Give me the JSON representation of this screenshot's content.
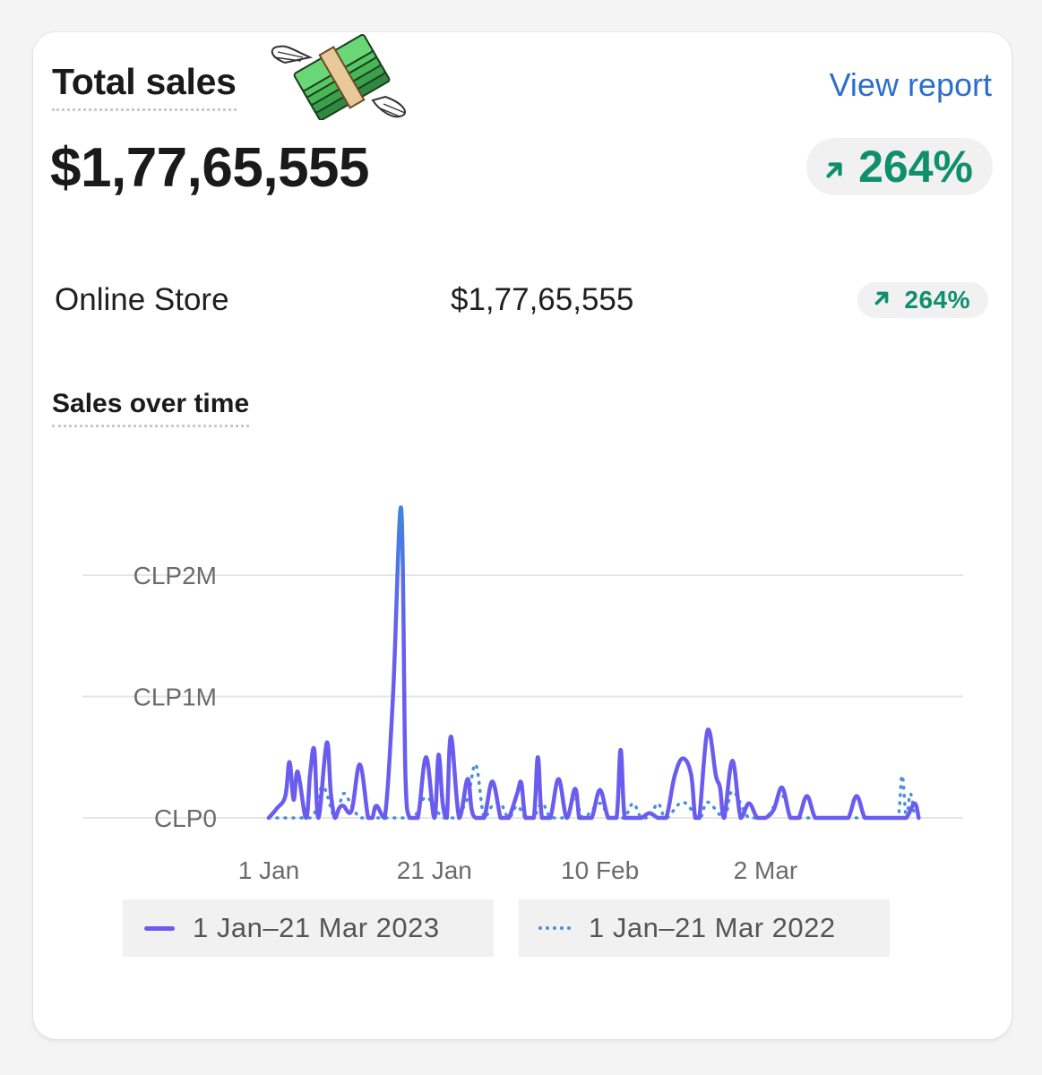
{
  "header": {
    "title": "Total sales",
    "view_report": "View report",
    "total_value": "$1,77,65,555",
    "change_pct": "264%",
    "change_icon": "arrow-up-right-icon",
    "illustration": "flying-money-icon"
  },
  "breakdown": [
    {
      "channel": "Online Store",
      "value": "$1,77,65,555",
      "change_pct": "264%"
    }
  ],
  "colors": {
    "accent_link": "#2c6ecb",
    "positive": "#0f8f6c",
    "series_current_top": "#3f85e0",
    "series_current": "#6b5cf0",
    "series_previous": "#4a90d9"
  },
  "chart_data": {
    "type": "line",
    "title": "Sales over time",
    "ylabel": "",
    "xlabel": "",
    "y_unit_prefix": "CLP",
    "ylim": [
      0,
      2000000
    ],
    "y_ticks": [
      0,
      1000000,
      2000000
    ],
    "y_tick_labels": [
      "CLP0",
      "CLP1M",
      "CLP2M"
    ],
    "x_ticks": [
      0,
      20,
      40,
      60
    ],
    "x_tick_labels": [
      "1 Jan",
      "21 Jan",
      "10 Feb",
      "2 Mar"
    ],
    "x_range": [
      0,
      79
    ],
    "grid": true,
    "legend": "bottom",
    "series": [
      {
        "name": "1 Jan–21 Mar 2023",
        "style": "solid",
        "x": [
          0,
          1,
          2,
          2.5,
          3,
          3.5,
          4.5,
          5,
          5.5,
          6,
          7,
          7.5,
          8,
          8.5,
          9,
          10,
          11,
          12,
          12.5,
          13,
          14,
          15,
          16,
          16.5,
          17,
          18,
          19,
          20,
          20.5,
          21,
          21.5,
          22,
          23,
          24,
          24.5,
          25,
          26,
          27,
          28,
          28.5,
          29,
          30,
          30.5,
          31,
          32,
          32.5,
          33,
          34,
          35,
          36,
          37,
          37.5,
          38,
          39,
          40,
          41,
          42,
          42.5,
          43,
          44,
          45,
          46,
          47,
          48,
          49,
          50,
          51,
          51.5,
          52,
          53,
          54,
          54.5,
          55,
          56,
          57,
          58,
          59,
          60,
          61,
          62,
          63,
          64,
          65,
          66,
          67,
          68,
          69,
          70,
          71,
          72,
          73,
          74,
          75,
          76,
          77,
          78,
          78.5
        ],
        "values": [
          0,
          80000,
          180000,
          460000,
          150000,
          380000,
          0,
          370000,
          560000,
          0,
          620000,
          200000,
          0,
          80000,
          100000,
          60000,
          440000,
          0,
          0,
          100000,
          0,
          1000000,
          2550000,
          350000,
          0,
          0,
          500000,
          0,
          520000,
          120000,
          0,
          670000,
          0,
          320000,
          70000,
          0,
          0,
          300000,
          0,
          0,
          0,
          200000,
          290000,
          0,
          0,
          500000,
          0,
          0,
          320000,
          0,
          240000,
          0,
          0,
          0,
          230000,
          0,
          0,
          560000,
          0,
          0,
          0,
          40000,
          0,
          0,
          340000,
          490000,
          360000,
          0,
          0,
          720000,
          350000,
          250000,
          0,
          470000,
          0,
          120000,
          0,
          0,
          70000,
          250000,
          0,
          0,
          180000,
          0,
          0,
          0,
          0,
          0,
          180000,
          0,
          0,
          0,
          0,
          0,
          0,
          120000,
          0
        ]
      },
      {
        "name": "1 Jan–21 Mar 2022",
        "style": "dotted",
        "x": [
          0,
          5,
          6.5,
          8,
          9,
          10,
          11,
          12,
          16,
          17.5,
          19,
          21,
          22.5,
          24,
          25,
          26,
          27,
          28,
          29,
          30,
          31,
          32,
          33,
          34,
          35,
          36,
          37,
          38,
          40,
          41,
          42,
          43,
          44,
          45,
          46,
          47,
          48,
          50,
          52,
          53,
          55,
          56,
          58,
          60,
          62,
          63,
          64,
          65,
          66,
          67,
          68,
          69,
          70,
          71,
          72,
          73,
          74,
          75,
          76,
          76.5,
          77,
          77.5,
          78
        ],
        "values": [
          0,
          0,
          260000,
          0,
          200000,
          100000,
          0,
          0,
          0,
          0,
          170000,
          0,
          0,
          160000,
          440000,
          0,
          100000,
          120000,
          0,
          100000,
          0,
          0,
          120000,
          0,
          0,
          0,
          170000,
          0,
          120000,
          0,
          0,
          0,
          120000,
          0,
          0,
          120000,
          0,
          130000,
          0,
          130000,
          0,
          220000,
          0,
          0,
          180000,
          0,
          0,
          0,
          0,
          0,
          0,
          0,
          0,
          0,
          0,
          0,
          0,
          0,
          0,
          350000,
          0,
          200000,
          0
        ]
      }
    ]
  }
}
